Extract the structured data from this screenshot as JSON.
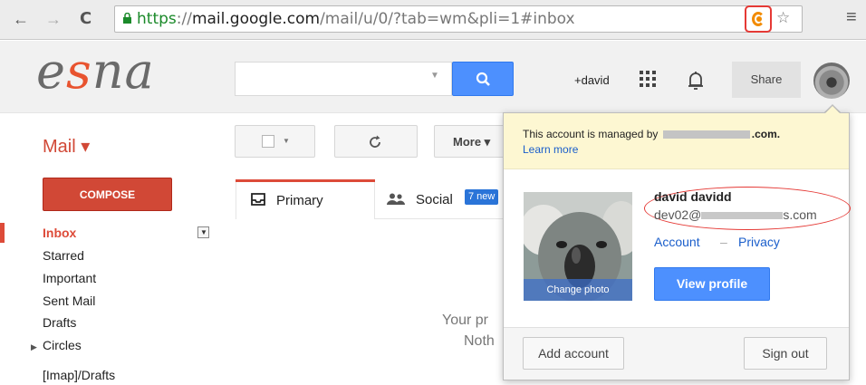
{
  "browser": {
    "back_icon": "←",
    "forward_icon": "→",
    "reload_icon": "C",
    "url_scheme": "https",
    "url_sep": "://",
    "url_host": "mail.google.com",
    "url_path": "/mail/u/0/?tab=wm&pli=1#inbox",
    "star_icon": "☆",
    "menu_icon": "≡"
  },
  "header": {
    "logo_prefix": "e",
    "logo_accent": "s",
    "logo_suffix": "na",
    "account_link": "+david",
    "share_label": "Share"
  },
  "toolbar": {
    "app_label": "Mail ▾",
    "more_label": "More ▾"
  },
  "sidebar": {
    "compose_label": "COMPOSE",
    "items": [
      {
        "label": "Inbox"
      },
      {
        "label": "Starred"
      },
      {
        "label": "Important"
      },
      {
        "label": "Sent Mail"
      },
      {
        "label": "Drafts"
      },
      {
        "label": "Circles"
      },
      {
        "label": "[Imap]/Drafts"
      }
    ]
  },
  "tabs": {
    "primary": "Primary",
    "social": "Social",
    "social_badge": "7 new"
  },
  "main": {
    "empty_line1": "Your pr",
    "empty_line2": "Noth"
  },
  "popup": {
    "managed_prefix": "This account is managed by",
    "managed_suffix": ".com.",
    "learn_more": "Learn more",
    "change_photo": "Change photo",
    "name": "david davidd",
    "email_prefix": "dev02@",
    "email_suffix": "s.com",
    "account_link": "Account",
    "separator": "–",
    "privacy_link": "Privacy",
    "view_profile": "View profile",
    "add_account": "Add account",
    "sign_out": "Sign out"
  },
  "colors": {
    "compose_red": "#d14836",
    "search_blue": "#4d90fe",
    "link_blue": "#1a5ecb",
    "managed_bg": "#fdf7d2",
    "brand_orange": "#e8532f"
  }
}
